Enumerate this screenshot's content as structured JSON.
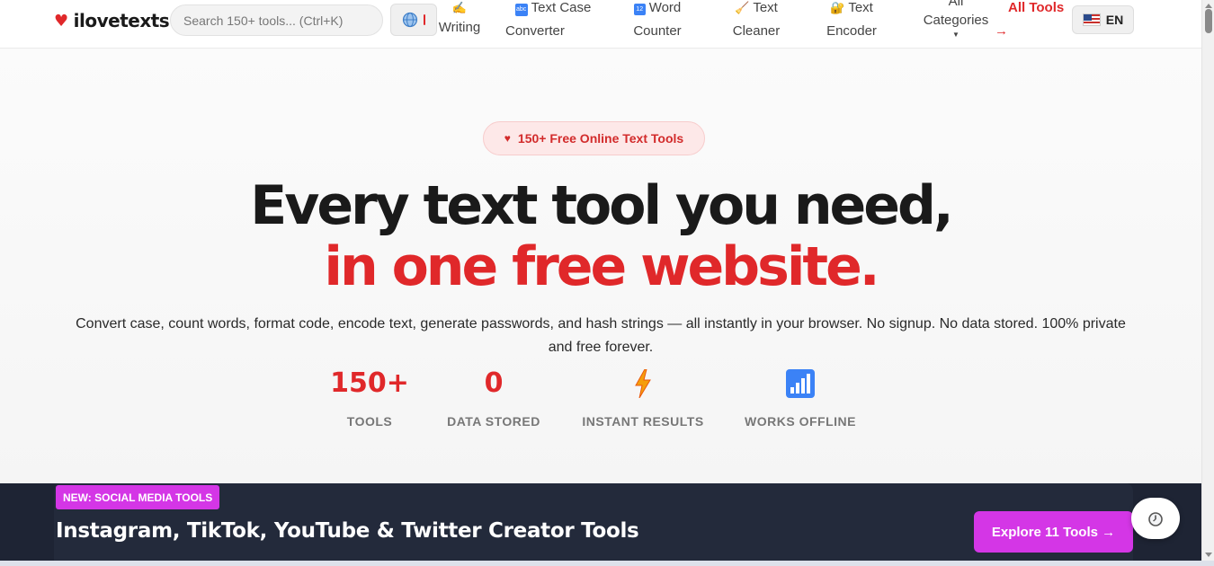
{
  "header": {
    "logo_text": "ilovetexts",
    "search_placeholder": "Search 150+ tools... (Ctrl+K)",
    "nav": [
      {
        "line1": "Writing",
        "line2": "",
        "icon": "writing-hand-icon"
      },
      {
        "line1": "Text Case",
        "line2": "Converter",
        "icon": "abc-icon"
      },
      {
        "line1": "Word",
        "line2": "Counter",
        "icon": "numbers-icon"
      },
      {
        "line1": "Text",
        "line2": "Cleaner",
        "icon": "broom-icon"
      },
      {
        "line1": "Text",
        "line2": "Encoder",
        "icon": "lock-icon"
      },
      {
        "line1": "All",
        "line2": "Categories",
        "icon": "chevron-down-icon"
      },
      {
        "line1": "All Tools",
        "line2": "→",
        "icon": ""
      }
    ],
    "language": "EN"
  },
  "hero": {
    "pill": "150+ Free Online Text Tools",
    "headline_line1": "Every text tool you need,",
    "headline_line2": "in one free website.",
    "subtitle": "Convert case, count words, format code, encode text, generate passwords, and hash strings — all instantly in your browser. No signup. No data stored. 100% private and free forever.",
    "stats": [
      {
        "value": "150+",
        "label": "TOOLS"
      },
      {
        "value": "0",
        "label": "DATA STORED"
      },
      {
        "value": "",
        "label": "INSTANT RESULTS",
        "icon": "lightning-icon"
      },
      {
        "value": "",
        "label": "WORKS OFFLINE",
        "icon": "bar-chart-icon"
      }
    ]
  },
  "banner": {
    "badge": "NEW: SOCIAL MEDIA TOOLS",
    "title": "Instagram, TikTok, YouTube & Twitter Creator Tools",
    "button": "Explore 11 Tools →"
  },
  "colors": {
    "brand_red": "#e0282a",
    "banner_bg": "#1e2434",
    "accent_purple": "#d436e6"
  }
}
